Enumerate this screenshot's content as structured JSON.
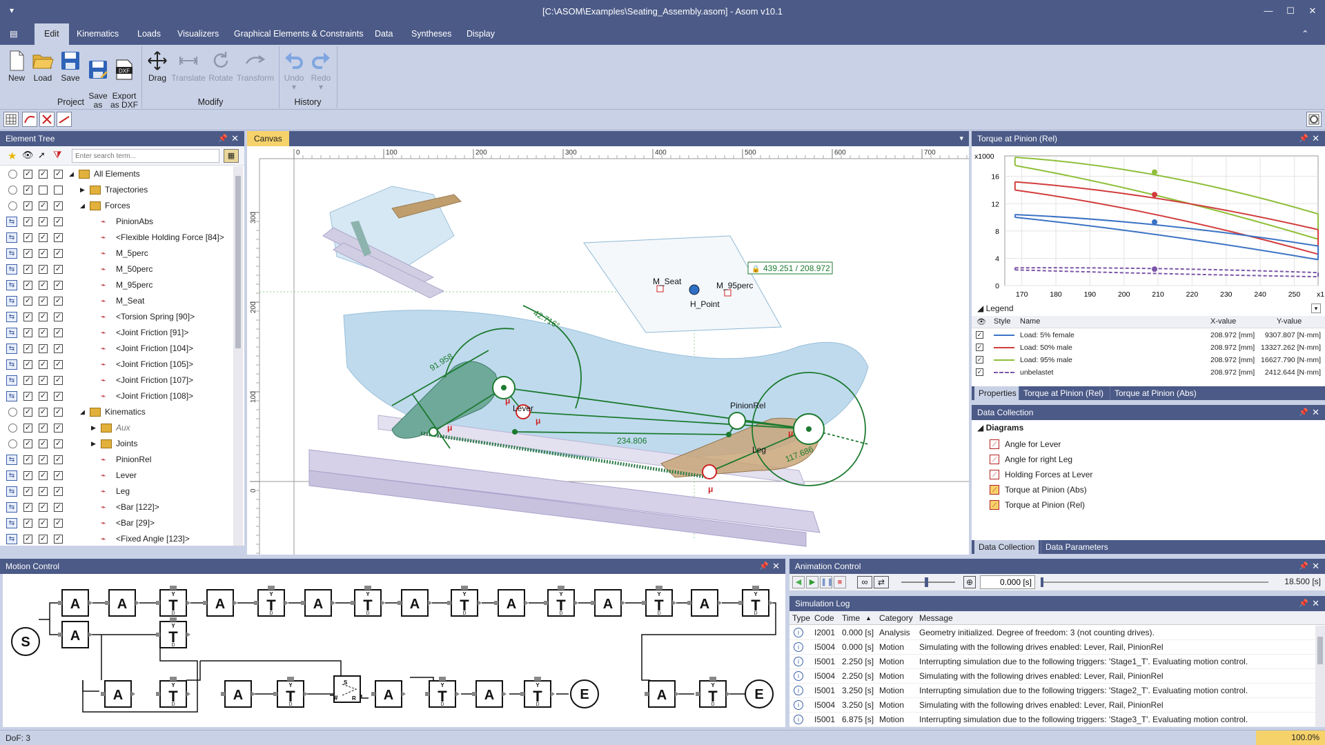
{
  "window": {
    "title": "[C:\\ASOM\\Examples\\Seating_Assembly.asom] - Asom v10.1"
  },
  "menus": [
    "Edit",
    "Kinematics",
    "Loads",
    "Visualizers",
    "Graphical Elements & Constraints",
    "Data",
    "Syntheses",
    "Display"
  ],
  "ribbon": {
    "project": {
      "label": "Project",
      "new": "New",
      "load": "Load",
      "save": "Save",
      "save_as": "Save\nas",
      "export": "Export\nas DXF",
      "dxf_text": "DXF"
    },
    "modify": {
      "label": "Modify",
      "drag": "Drag",
      "translate": "Translate",
      "rotate": "Rotate",
      "transform": "Transform"
    },
    "history": {
      "label": "History",
      "undo": "Undo",
      "redo": "Redo"
    }
  },
  "element_tree": {
    "title": "Element Tree",
    "search_placeholder": "Enter search term...",
    "rows": [
      {
        "label": "All Elements",
        "level": 0,
        "folder": true,
        "expanded": true
      },
      {
        "label": "Trajectories",
        "level": 1,
        "folder": true,
        "expanded": false
      },
      {
        "label": "Forces",
        "level": 1,
        "folder": true,
        "expanded": true
      },
      {
        "label": "PinionAbs",
        "level": 2
      },
      {
        "label": "<Flexible Holding Force [84]>",
        "level": 2
      },
      {
        "label": "M_5perc",
        "level": 2
      },
      {
        "label": "M_50perc",
        "level": 2
      },
      {
        "label": "M_95perc",
        "level": 2
      },
      {
        "label": "M_Seat",
        "level": 2
      },
      {
        "label": "<Torsion Spring [90]>",
        "level": 2
      },
      {
        "label": "<Joint Friction [91]>",
        "level": 2
      },
      {
        "label": "<Joint Friction [104]>",
        "level": 2
      },
      {
        "label": "<Joint Friction [105]>",
        "level": 2
      },
      {
        "label": "<Joint Friction [107]>",
        "level": 2
      },
      {
        "label": "<Joint Friction [108]>",
        "level": 2
      },
      {
        "label": "Kinematics",
        "level": 1,
        "folder": true,
        "expanded": true
      },
      {
        "label": "Aux",
        "level": 2,
        "folder": true,
        "expanded": false,
        "italic": true
      },
      {
        "label": "Joints",
        "level": 2,
        "folder": true,
        "expanded": false
      },
      {
        "label": "PinionRel",
        "level": 2
      },
      {
        "label": "Lever",
        "level": 2
      },
      {
        "label": "Leg",
        "level": 2
      },
      {
        "label": "<Bar [122]>",
        "level": 2
      },
      {
        "label": "<Bar [29]>",
        "level": 2
      },
      {
        "label": "<Fixed Angle [123]>",
        "level": 2
      }
    ]
  },
  "canvas": {
    "tab": "Canvas",
    "ruler_x": [
      "0",
      "100",
      "200",
      "300",
      "400",
      "500",
      "600",
      "700"
    ],
    "ruler_y": [
      "300",
      "200",
      "100",
      "0"
    ],
    "dims": {
      "d1": "91.958",
      "d2": "42.716°",
      "d3": "234.806",
      "d4": "117.686",
      "coord": "439.251 / 208.972"
    },
    "labels": {
      "m_seat": "M_Seat",
      "h_point": "H_Point",
      "m_95": "M_95perc",
      "pinionrel": "PinionRel",
      "lever": "Lever",
      "leg": "Leg",
      "mu": "μ"
    }
  },
  "torque_chart": {
    "title": "Torque at Pinion (Rel)",
    "legend_title": "Legend",
    "columns": [
      "Style",
      "Name",
      "X-value",
      "Y-value"
    ],
    "entries": [
      {
        "name": "Load: 5% female",
        "x": "208.972 [mm]",
        "y": "9307.807 [N·mm]",
        "color": "#3a72c4",
        "dash": false
      },
      {
        "name": "Load: 50% male",
        "x": "208.972 [mm]",
        "y": "13327.262 [N·mm]",
        "color": "#d23c3c",
        "dash": false
      },
      {
        "name": "Load: 95% male",
        "x": "208.972 [mm]",
        "y": "16627.790 [N·mm]",
        "color": "#8fbf3a",
        "dash": false
      },
      {
        "name": "unbelastet",
        "x": "208.972 [mm]",
        "y": "2412.644 [N·mm]",
        "color": "#7b55a8",
        "dash": true
      }
    ],
    "tabs": [
      "Properties",
      "Torque at Pinion (Rel)",
      "Torque at Pinion (Abs)"
    ]
  },
  "chart_data": {
    "type": "line",
    "ylabel_multiplier": "x1000",
    "xlabel_multiplier": "x1",
    "x_ticks": [
      170,
      180,
      190,
      200,
      210,
      220,
      230,
      240,
      250
    ],
    "y_ticks": [
      0,
      4,
      8,
      12,
      16
    ],
    "xlim": [
      165,
      257
    ],
    "ylim": [
      0,
      19
    ],
    "grid": true,
    "series": [
      {
        "name": "Load: 95% male",
        "color": "#8fbf3a",
        "x": [
          168,
          210,
          257
        ],
        "upper": [
          18.8,
          17.2,
          10.5
        ],
        "lower": [
          17.6,
          14.2,
          6.8
        ]
      },
      {
        "name": "Load: 50% male",
        "color": "#d23c3c",
        "x": [
          168,
          210,
          257
        ],
        "upper": [
          15.2,
          13.4,
          8.2
        ],
        "lower": [
          14.0,
          11.5,
          4.6
        ]
      },
      {
        "name": "Load: 5% female",
        "color": "#3a72c4",
        "x": [
          168,
          210,
          257
        ],
        "upper": [
          10.4,
          9.3,
          5.8
        ],
        "lower": [
          10.0,
          8.2,
          3.8
        ]
      },
      {
        "name": "unbelastet",
        "color": "#7b55a8",
        "x": [
          168,
          210,
          257
        ],
        "upper": [
          2.6,
          2.5,
          1.9
        ],
        "lower": [
          2.3,
          2.1,
          1.3
        ]
      }
    ],
    "marker_x": 208.972,
    "marker_y": [
      9.307807,
      13.327262,
      16.62779,
      2.412644
    ]
  },
  "data_collection": {
    "title": "Data Collection",
    "root": "Diagrams",
    "items": [
      "Angle for Lever",
      "Angle for right Leg",
      "Holding Forces at Lever",
      "Torque at Pinion (Abs)",
      "Torque at Pinion (Rel)"
    ],
    "tabs": [
      "Data Collection",
      "Data Parameters"
    ]
  },
  "motion_control": {
    "title": "Motion Control",
    "start": "S",
    "end": "E",
    "block_a": "A",
    "block_t": "T",
    "small_y": "Y",
    "small_d": "D",
    "small_s": "S",
    "small_r": "R",
    "small_hash": "#"
  },
  "animation_control": {
    "title": "Animation Control",
    "time": "0.000 [s]",
    "end_time": "18.500 [s]",
    "progress": 0
  },
  "simulation_log": {
    "title": "Simulation Log",
    "columns": [
      "Type",
      "Code",
      "Time",
      "Category",
      "Message"
    ],
    "rows": [
      {
        "code": "I2001",
        "time": "0.000 [s]",
        "category": "Analysis",
        "message": "Geometry initialized. Degree of freedom: 3 (not counting drives)."
      },
      {
        "code": "I5004",
        "time": "0.000 [s]",
        "category": "Motion",
        "message": "Simulating with the following drives enabled: Lever, Rail, PinionRel"
      },
      {
        "code": "I5001",
        "time": "2.250 [s]",
        "category": "Motion",
        "message": "Interrupting simulation due to the following triggers: 'Stage1_T'. Evaluating motion control."
      },
      {
        "code": "I5004",
        "time": "2.250 [s]",
        "category": "Motion",
        "message": "Simulating with the following drives enabled: Lever, Rail, PinionRel"
      },
      {
        "code": "I5001",
        "time": "3.250 [s]",
        "category": "Motion",
        "message": "Interrupting simulation due to the following triggers: 'Stage2_T'. Evaluating motion control."
      },
      {
        "code": "I5004",
        "time": "3.250 [s]",
        "category": "Motion",
        "message": "Simulating with the following drives enabled: Lever, Rail, PinionRel"
      },
      {
        "code": "I5001",
        "time": "6.875 [s]",
        "category": "Motion",
        "message": "Interrupting simulation due to the following triggers: 'Stage3_T'. Evaluating motion control."
      }
    ]
  },
  "status": {
    "dof": "DoF: 3",
    "zoom": "100.0%"
  }
}
